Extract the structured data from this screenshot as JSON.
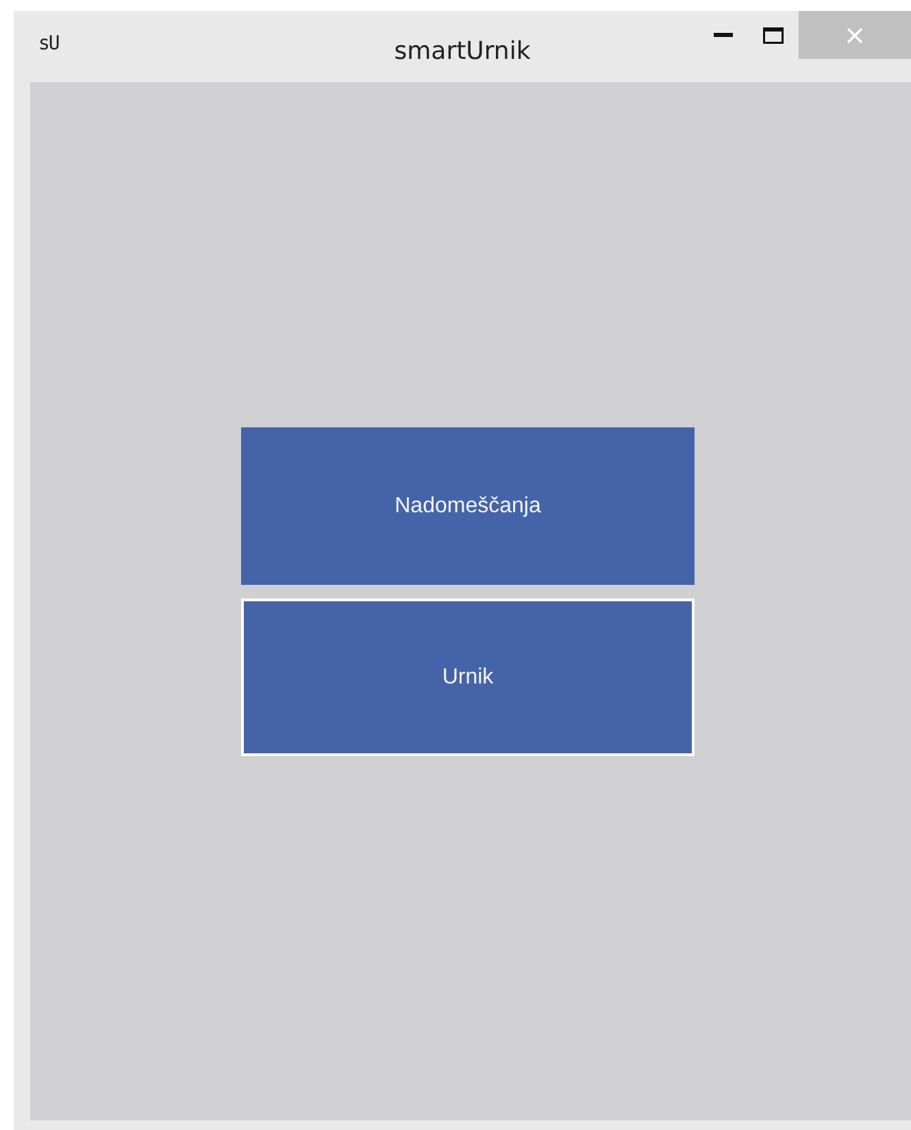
{
  "window": {
    "title": "smartUrnik",
    "icon_text": "sU"
  },
  "buttons": [
    {
      "label": "Nadomeščanja",
      "focused": false
    },
    {
      "label": "Urnik",
      "focused": true
    }
  ]
}
